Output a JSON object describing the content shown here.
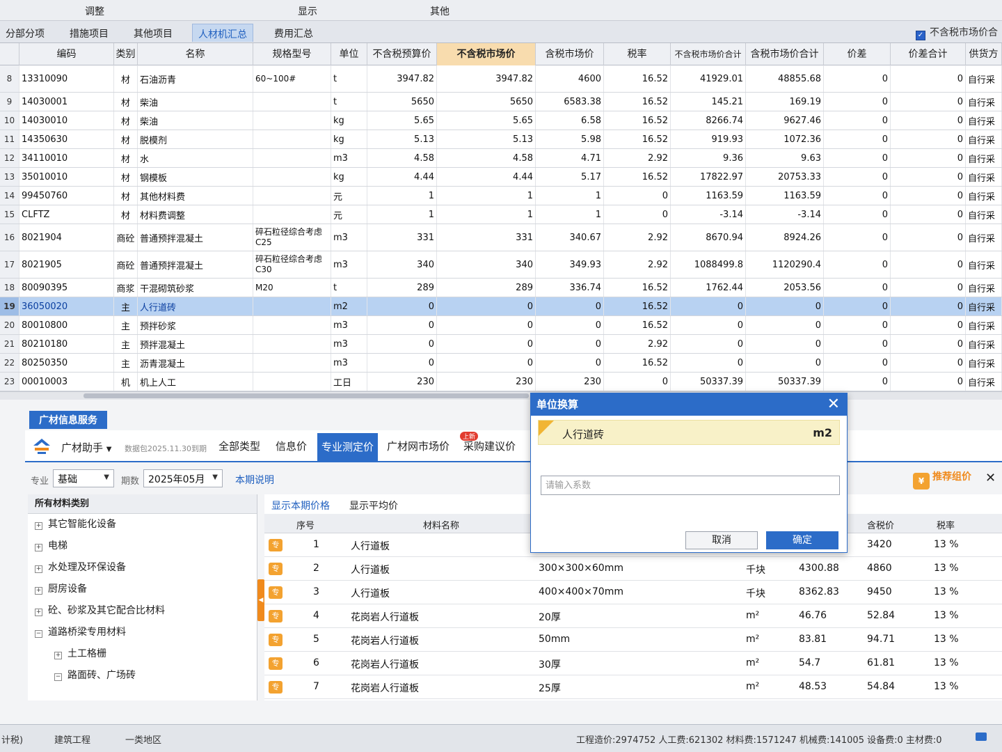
{
  "menubar": {
    "items": [
      "调整",
      "显示",
      "其他"
    ]
  },
  "tabs": [
    "分部分项",
    "措施项目",
    "其他项目",
    "人材机汇总",
    "费用汇总"
  ],
  "top_checkbox_label": "不含税市场价合",
  "grid": {
    "headers": [
      "编码",
      "类别",
      "名称",
      "规格型号",
      "单位",
      "不含税预算价",
      "不含税市场价",
      "含税市场价",
      "税率",
      "不含税市场价合计",
      "含税市场价合计",
      "价差",
      "价差合计",
      "供货方"
    ],
    "rows": [
      {
        "n": "8",
        "code": "13310090",
        "type": "材",
        "name": "石油沥青",
        "spec": "60~100#",
        "unit": "t",
        "budget": "3947.82",
        "market": "3947.82",
        "tax_market": "4600",
        "rate": "16.52",
        "sum": "41929.01",
        "tax_sum": "48855.68",
        "diff": "0",
        "diff_sum": "0",
        "supply": "自行采"
      },
      {
        "n": "9",
        "code": "14030001",
        "type": "材",
        "name": "柴油",
        "spec": "",
        "unit": "t",
        "budget": "5650",
        "market": "5650",
        "tax_market": "6583.38",
        "rate": "16.52",
        "sum": "145.21",
        "tax_sum": "169.19",
        "diff": "0",
        "diff_sum": "0",
        "supply": "自行采"
      },
      {
        "n": "10",
        "code": "14030010",
        "type": "材",
        "name": "柴油",
        "spec": "",
        "unit": "kg",
        "budget": "5.65",
        "market": "5.65",
        "tax_market": "6.58",
        "rate": "16.52",
        "sum": "8266.74",
        "tax_sum": "9627.46",
        "diff": "0",
        "diff_sum": "0",
        "supply": "自行采"
      },
      {
        "n": "11",
        "code": "14350630",
        "type": "材",
        "name": "脱模剂",
        "spec": "",
        "unit": "kg",
        "budget": "5.13",
        "market": "5.13",
        "tax_market": "5.98",
        "rate": "16.52",
        "sum": "919.93",
        "tax_sum": "1072.36",
        "diff": "0",
        "diff_sum": "0",
        "supply": "自行采"
      },
      {
        "n": "12",
        "code": "34110010",
        "type": "材",
        "name": "水",
        "spec": "",
        "unit": "m3",
        "budget": "4.58",
        "market": "4.58",
        "tax_market": "4.71",
        "rate": "2.92",
        "sum": "9.36",
        "tax_sum": "9.63",
        "diff": "0",
        "diff_sum": "0",
        "supply": "自行采"
      },
      {
        "n": "13",
        "code": "35010010",
        "type": "材",
        "name": "钢模板",
        "spec": "",
        "unit": "kg",
        "budget": "4.44",
        "market": "4.44",
        "tax_market": "5.17",
        "rate": "16.52",
        "sum": "17822.97",
        "tax_sum": "20753.33",
        "diff": "0",
        "diff_sum": "0",
        "supply": "自行采"
      },
      {
        "n": "14",
        "code": "99450760",
        "type": "材",
        "name": "其他材料费",
        "spec": "",
        "unit": "元",
        "budget": "1",
        "market": "1",
        "tax_market": "1",
        "rate": "0",
        "sum": "1163.59",
        "tax_sum": "1163.59",
        "diff": "0",
        "diff_sum": "0",
        "supply": "自行采"
      },
      {
        "n": "15",
        "code": "CLFTZ",
        "type": "材",
        "name": "材料费调整",
        "spec": "",
        "unit": "元",
        "budget": "1",
        "market": "1",
        "tax_market": "1",
        "rate": "0",
        "sum": "-3.14",
        "tax_sum": "-3.14",
        "diff": "0",
        "diff_sum": "0",
        "supply": "自行采"
      },
      {
        "n": "16",
        "code": "8021904",
        "type": "商砼",
        "name": "普通预拌混凝土",
        "spec": "碎石粒径综合考虑 C25",
        "unit": "m3",
        "budget": "331",
        "market": "331",
        "tax_market": "340.67",
        "rate": "2.92",
        "sum": "8670.94",
        "tax_sum": "8924.26",
        "diff": "0",
        "diff_sum": "0",
        "supply": "自行采"
      },
      {
        "n": "17",
        "code": "8021905",
        "type": "商砼",
        "name": "普通预拌混凝土",
        "spec": "碎石粒径综合考虑 C30",
        "unit": "m3",
        "budget": "340",
        "market": "340",
        "tax_market": "349.93",
        "rate": "2.92",
        "sum": "1088499.8",
        "tax_sum": "1120290.4",
        "diff": "0",
        "diff_sum": "0",
        "supply": "自行采"
      },
      {
        "n": "18",
        "code": "80090395",
        "type": "商浆",
        "name": "干混砌筑砂浆",
        "spec": "M20",
        "unit": "t",
        "budget": "289",
        "market": "289",
        "tax_market": "336.74",
        "rate": "16.52",
        "sum": "1762.44",
        "tax_sum": "2053.56",
        "diff": "0",
        "diff_sum": "0",
        "supply": "自行采"
      },
      {
        "n": "19",
        "code": "36050020",
        "type": "主",
        "name": "人行道砖",
        "spec": "",
        "unit": "m2",
        "budget": "0",
        "market": "0",
        "tax_market": "0",
        "rate": "16.52",
        "sum": "0",
        "tax_sum": "0",
        "diff": "0",
        "diff_sum": "0",
        "supply": "自行采"
      },
      {
        "n": "20",
        "code": "80010800",
        "type": "主",
        "name": "预拌砂浆",
        "spec": "",
        "unit": "m3",
        "budget": "0",
        "market": "0",
        "tax_market": "0",
        "rate": "16.52",
        "sum": "0",
        "tax_sum": "0",
        "diff": "0",
        "diff_sum": "0",
        "supply": "自行采"
      },
      {
        "n": "21",
        "code": "80210180",
        "type": "主",
        "name": "预拌混凝土",
        "spec": "",
        "unit": "m3",
        "budget": "0",
        "market": "0",
        "tax_market": "0",
        "rate": "2.92",
        "sum": "0",
        "tax_sum": "0",
        "diff": "0",
        "diff_sum": "0",
        "supply": "自行采"
      },
      {
        "n": "22",
        "code": "80250350",
        "type": "主",
        "name": "沥青混凝土",
        "spec": "",
        "unit": "m3",
        "budget": "0",
        "market": "0",
        "tax_market": "0",
        "rate": "16.52",
        "sum": "0",
        "tax_sum": "0",
        "diff": "0",
        "diff_sum": "0",
        "supply": "自行采"
      },
      {
        "n": "23",
        "code": "00010003",
        "type": "机",
        "name": "机上人工",
        "spec": "",
        "unit": "工日",
        "budget": "230",
        "market": "230",
        "tax_market": "230",
        "rate": "0",
        "sum": "50337.39",
        "tax_sum": "50337.39",
        "diff": "0",
        "diff_sum": "0",
        "supply": "自行采"
      }
    ]
  },
  "service": {
    "title": "广材信息服务",
    "assistant_label": "广材助手",
    "data_pack": "数据包2025.11.30到期",
    "tabs": [
      "全部类型",
      "信息价",
      "专业测定价",
      "广材网市场价",
      "采购建议价"
    ],
    "new_badge": "上新",
    "filter": {
      "major_label": "专业",
      "major_value": "基础",
      "period_label": "期数",
      "period_value": "2025年05月",
      "period_note": "本期说明"
    },
    "category_header": "所有材料类别",
    "categories": [
      {
        "label": "其它智能化设备",
        "exp": "+"
      },
      {
        "label": "电梯",
        "exp": "+"
      },
      {
        "label": "水处理及环保设备",
        "exp": "+"
      },
      {
        "label": "厨房设备",
        "exp": "+"
      },
      {
        "label": "砼、砂浆及其它配合比材料",
        "exp": "+"
      },
      {
        "label": "道路桥梁专用材料",
        "exp": "−"
      },
      {
        "label": "土工格栅",
        "exp": "+"
      },
      {
        "label": "路面砖、广场砖",
        "exp": "−"
      }
    ],
    "result_tabs": [
      "显示本期价格",
      "显示平均价"
    ],
    "result_headers": [
      "序号",
      "材料名称",
      "含税价",
      "税率"
    ],
    "results": [
      {
        "no": "1",
        "name": "人行道板",
        "spec": "",
        "unit": "",
        "price": "",
        "tax_price": "3420",
        "rate": "13 %"
      },
      {
        "no": "2",
        "name": "人行道板",
        "spec": "300×300×60mm",
        "unit": "千块",
        "price": "4300.88",
        "tax_price": "4860",
        "rate": "13 %"
      },
      {
        "no": "3",
        "name": "人行道板",
        "spec": "400×400×70mm",
        "unit": "千块",
        "price": "8362.83",
        "tax_price": "9450",
        "rate": "13 %"
      },
      {
        "no": "4",
        "name": "花岗岩人行道板",
        "spec": "20厚",
        "unit": "m²",
        "price": "46.76",
        "tax_price": "52.84",
        "rate": "13 %"
      },
      {
        "no": "5",
        "name": "花岗岩人行道板",
        "spec": "50mm",
        "unit": "m²",
        "price": "83.81",
        "tax_price": "94.71",
        "rate": "13 %"
      },
      {
        "no": "6",
        "name": "花岗岩人行道板",
        "spec": "30厚",
        "unit": "m²",
        "price": "54.7",
        "tax_price": "61.81",
        "rate": "13 %"
      },
      {
        "no": "7",
        "name": "花岗岩人行道板",
        "spec": "25厚",
        "unit": "m²",
        "price": "48.53",
        "tax_price": "54.84",
        "rate": "13 %"
      }
    ],
    "pro_icon_text": "专",
    "recommend_label": "推荐组价"
  },
  "dialog": {
    "title": "单位换算",
    "material": "人行道砖",
    "unit": "m2",
    "placeholder": "请输入系数",
    "cancel": "取消",
    "ok": "确定"
  },
  "statusbar": {
    "left1": "计税)",
    "left2": "建筑工程",
    "left3": "一类地区",
    "summary": "工程造价:2974752  人工费:621302  材料费:1571247  机械费:141005  设备费:0  主材费:0"
  },
  "colors": {
    "accent": "#2c6cc8",
    "highlight_header": "#f8dcae",
    "selected_row": "#b8d2f2"
  }
}
